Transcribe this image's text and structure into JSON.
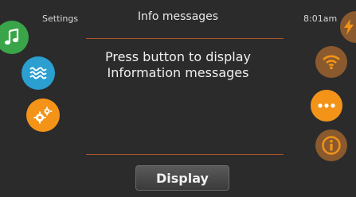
{
  "header": {
    "settings_label": "Settings",
    "title": "Info messages",
    "time": "8:01am"
  },
  "message": {
    "line1": "Press button to display",
    "line2": "Information messages"
  },
  "actions": {
    "display_label": "Display"
  },
  "icons": {
    "left": [
      "music-icon",
      "water-waves-icon",
      "gears-icon"
    ],
    "right": [
      "lightning-icon",
      "wifi-icon",
      "more-dots-icon",
      "info-icon"
    ]
  },
  "colors": {
    "background": "#2b2b2b",
    "music": "#3aa548",
    "water": "#2a9fd0",
    "orange": "#f39419",
    "brown": "#8a5a2e",
    "divider": "#a8552a"
  }
}
